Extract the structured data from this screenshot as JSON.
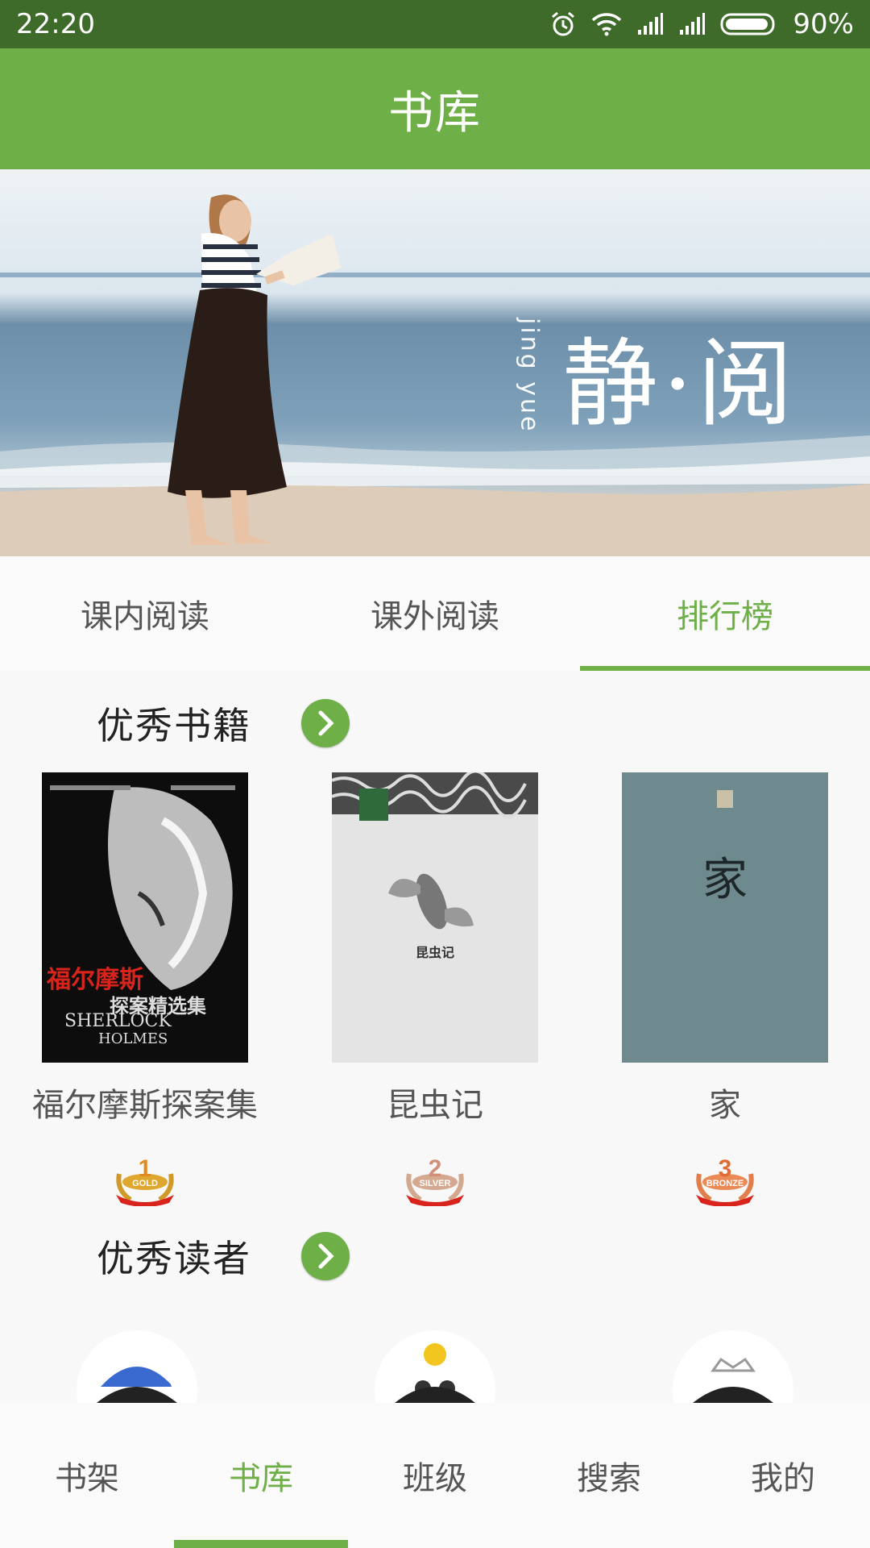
{
  "status_bar": {
    "time": "22:20",
    "battery": "90%"
  },
  "header": {
    "title": "书库"
  },
  "banner": {
    "subtitle": "jing yue",
    "title": "静·阅",
    "active_dot": 3
  },
  "tabs": [
    {
      "label": "课内阅读"
    },
    {
      "label": "课外阅读"
    },
    {
      "label": "排行榜",
      "active": true
    }
  ],
  "sections": {
    "books_title": "优秀书籍",
    "readers_title": "优秀读者"
  },
  "books": [
    {
      "name": "福尔摩斯探案集",
      "cover_text_cn": "福尔摩斯",
      "cover_text_cn2": "探案精选集",
      "cover_text_en1": "SHERLOCK",
      "cover_text_en2": "HOLMES",
      "rank": "1",
      "medal": "GOLD"
    },
    {
      "name": "昆虫记",
      "cover_text": "昆虫记",
      "rank": "2",
      "medal": "SILVER"
    },
    {
      "name": "家",
      "cover_text": "家",
      "rank": "3",
      "medal": "BRONZE"
    }
  ],
  "bottom_nav": [
    {
      "label": "书架"
    },
    {
      "label": "书库",
      "active": true
    },
    {
      "label": "班级"
    },
    {
      "label": "搜索"
    },
    {
      "label": "我的"
    }
  ],
  "colors": {
    "accent": "#6eaf48",
    "status_bar": "#3e6b2a",
    "gold": "#e5a632"
  }
}
